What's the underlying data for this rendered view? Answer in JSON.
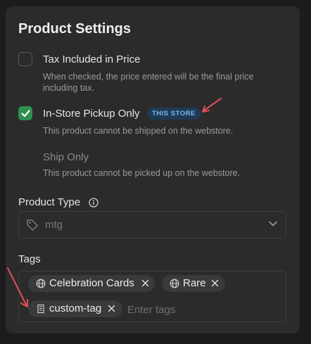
{
  "panel": {
    "title": "Product Settings"
  },
  "options": [
    {
      "label": "Tax Included in Price",
      "checked": false,
      "description": "When checked, the price entered will be the final price including tax."
    },
    {
      "label": "In-Store Pickup Only",
      "checked": true,
      "badge": "THIS STORE",
      "description": "This product cannot be shipped on the webstore."
    },
    {
      "label": "Ship Only",
      "disabled": true,
      "description": "This product cannot be picked up on the webstore."
    }
  ],
  "product_type": {
    "label": "Product Type",
    "info_icon": "info-icon",
    "value": "mtg",
    "icon": "tag-icon",
    "chevron": "chevron-down-icon"
  },
  "tags": {
    "label": "Tags",
    "items": [
      {
        "text": "Celebration Cards",
        "icon": "globe-icon"
      },
      {
        "text": "Rare",
        "icon": "globe-icon"
      },
      {
        "text": "custom-tag",
        "icon": "building-icon"
      }
    ],
    "placeholder": "Enter tags"
  },
  "colors": {
    "check_green": "#2f8f4e",
    "badge_bg": "#1e3a55",
    "badge_text": "#7cb9f0",
    "annotation_arrow": "#e0505a"
  }
}
